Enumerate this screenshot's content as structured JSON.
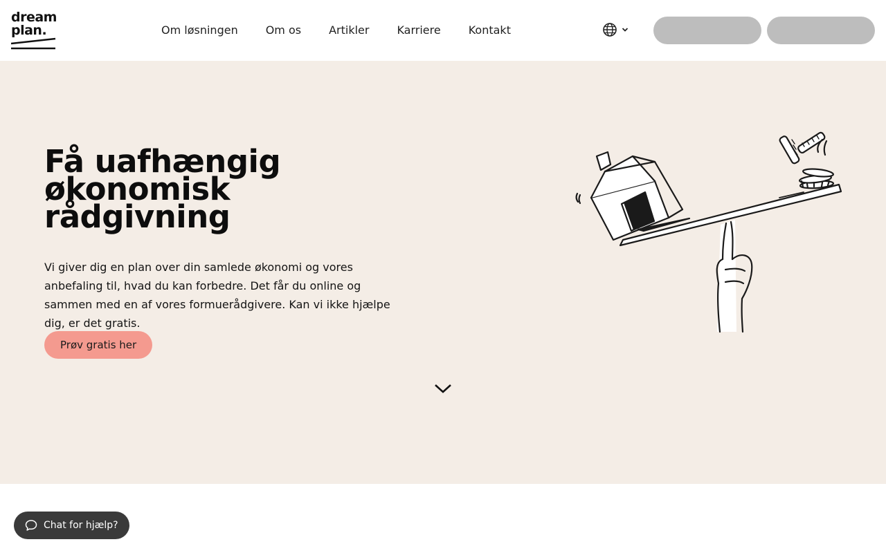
{
  "header": {
    "logo": {
      "line1": "dream",
      "line2": "plan."
    },
    "nav": [
      "Om løsningen",
      "Om os",
      "Artikler",
      "Karriere",
      "Kontakt"
    ],
    "language_icon": "globe-icon",
    "buttons": [
      "",
      ""
    ]
  },
  "hero": {
    "title_lines": [
      "Få uafhængig",
      "økonomisk",
      "rådgivning"
    ],
    "description": "Vi giver dig en plan over din samlede økonomi og vores anbefaling til, hvad du kan forbedre. Det får du online og sammen med en af vores formuerådgivere. Kan vi ikke hjælpe dig, er det gratis.",
    "cta": "Prøv gratis her",
    "scroll_icon": "chevron-down-icon",
    "background": "#f4ede6",
    "cta_color": "#f49a8f"
  },
  "chat": {
    "label": "Chat for hjælp?",
    "icon": "chat-bubble-icon"
  }
}
